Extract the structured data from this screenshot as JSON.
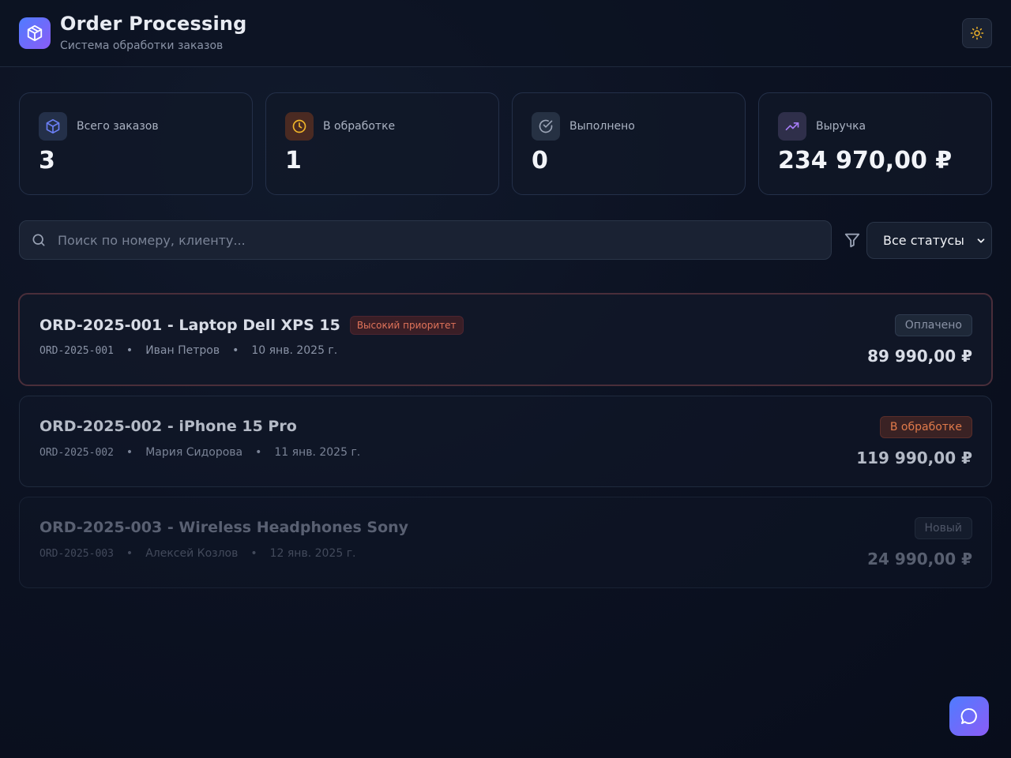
{
  "header": {
    "title": "Order Processing",
    "subtitle": "Система обработки заказов",
    "logo_icon": "box-icon",
    "theme_toggle_icon": "sun-icon"
  },
  "stats": [
    {
      "label": "Всего заказов",
      "value": "3",
      "icon": "box-icon",
      "accent": "#6b7ff5"
    },
    {
      "label": "В обработке",
      "value": "1",
      "icon": "clock-icon",
      "accent": "#f0b429"
    },
    {
      "label": "Выполнено",
      "value": "0",
      "icon": "check-circle-icon",
      "accent": "#9aa3b5"
    },
    {
      "label": "Выручка",
      "value": "234 970,00 ₽",
      "icon": "trending-up-icon",
      "accent": "#a67cf7"
    }
  ],
  "search": {
    "placeholder": "Поиск по номеру, клиенту...",
    "value": ""
  },
  "filter": {
    "selected": "Все статусы"
  },
  "orders": [
    {
      "title": "ORD-2025-001 - Laptop Dell XPS 15",
      "priority_badge": "Высокий приоритет",
      "code": "ORD-2025-001",
      "customer": "Иван Петров",
      "date": "10 янв. 2025 г.",
      "status": "Оплачено",
      "amount": "89 990,00 ₽"
    },
    {
      "title": "ORD-2025-002 - iPhone 15 Pro",
      "priority_badge": "",
      "code": "ORD-2025-002",
      "customer": "Мария Сидорова",
      "date": "11 янв. 2025 г.",
      "status": "В обработке",
      "amount": "119 990,00 ₽"
    },
    {
      "title": "ORD-2025-003 - Wireless Headphones Sony",
      "priority_badge": "",
      "code": "ORD-2025-003",
      "customer": "Алексей Козлов",
      "date": "12 янв. 2025 г.",
      "status": "Новый",
      "amount": "24 990,00 ₽"
    }
  ],
  "colors": {
    "accent_gradient_start": "#4f7cff",
    "accent_gradient_end": "#8b5cf6",
    "status_paid": "#8a93a6",
    "status_processing": "#e07a4a",
    "status_new": "#6b7386",
    "priority_high": "#e0735a"
  },
  "chat_button_icon": "chat-icon"
}
